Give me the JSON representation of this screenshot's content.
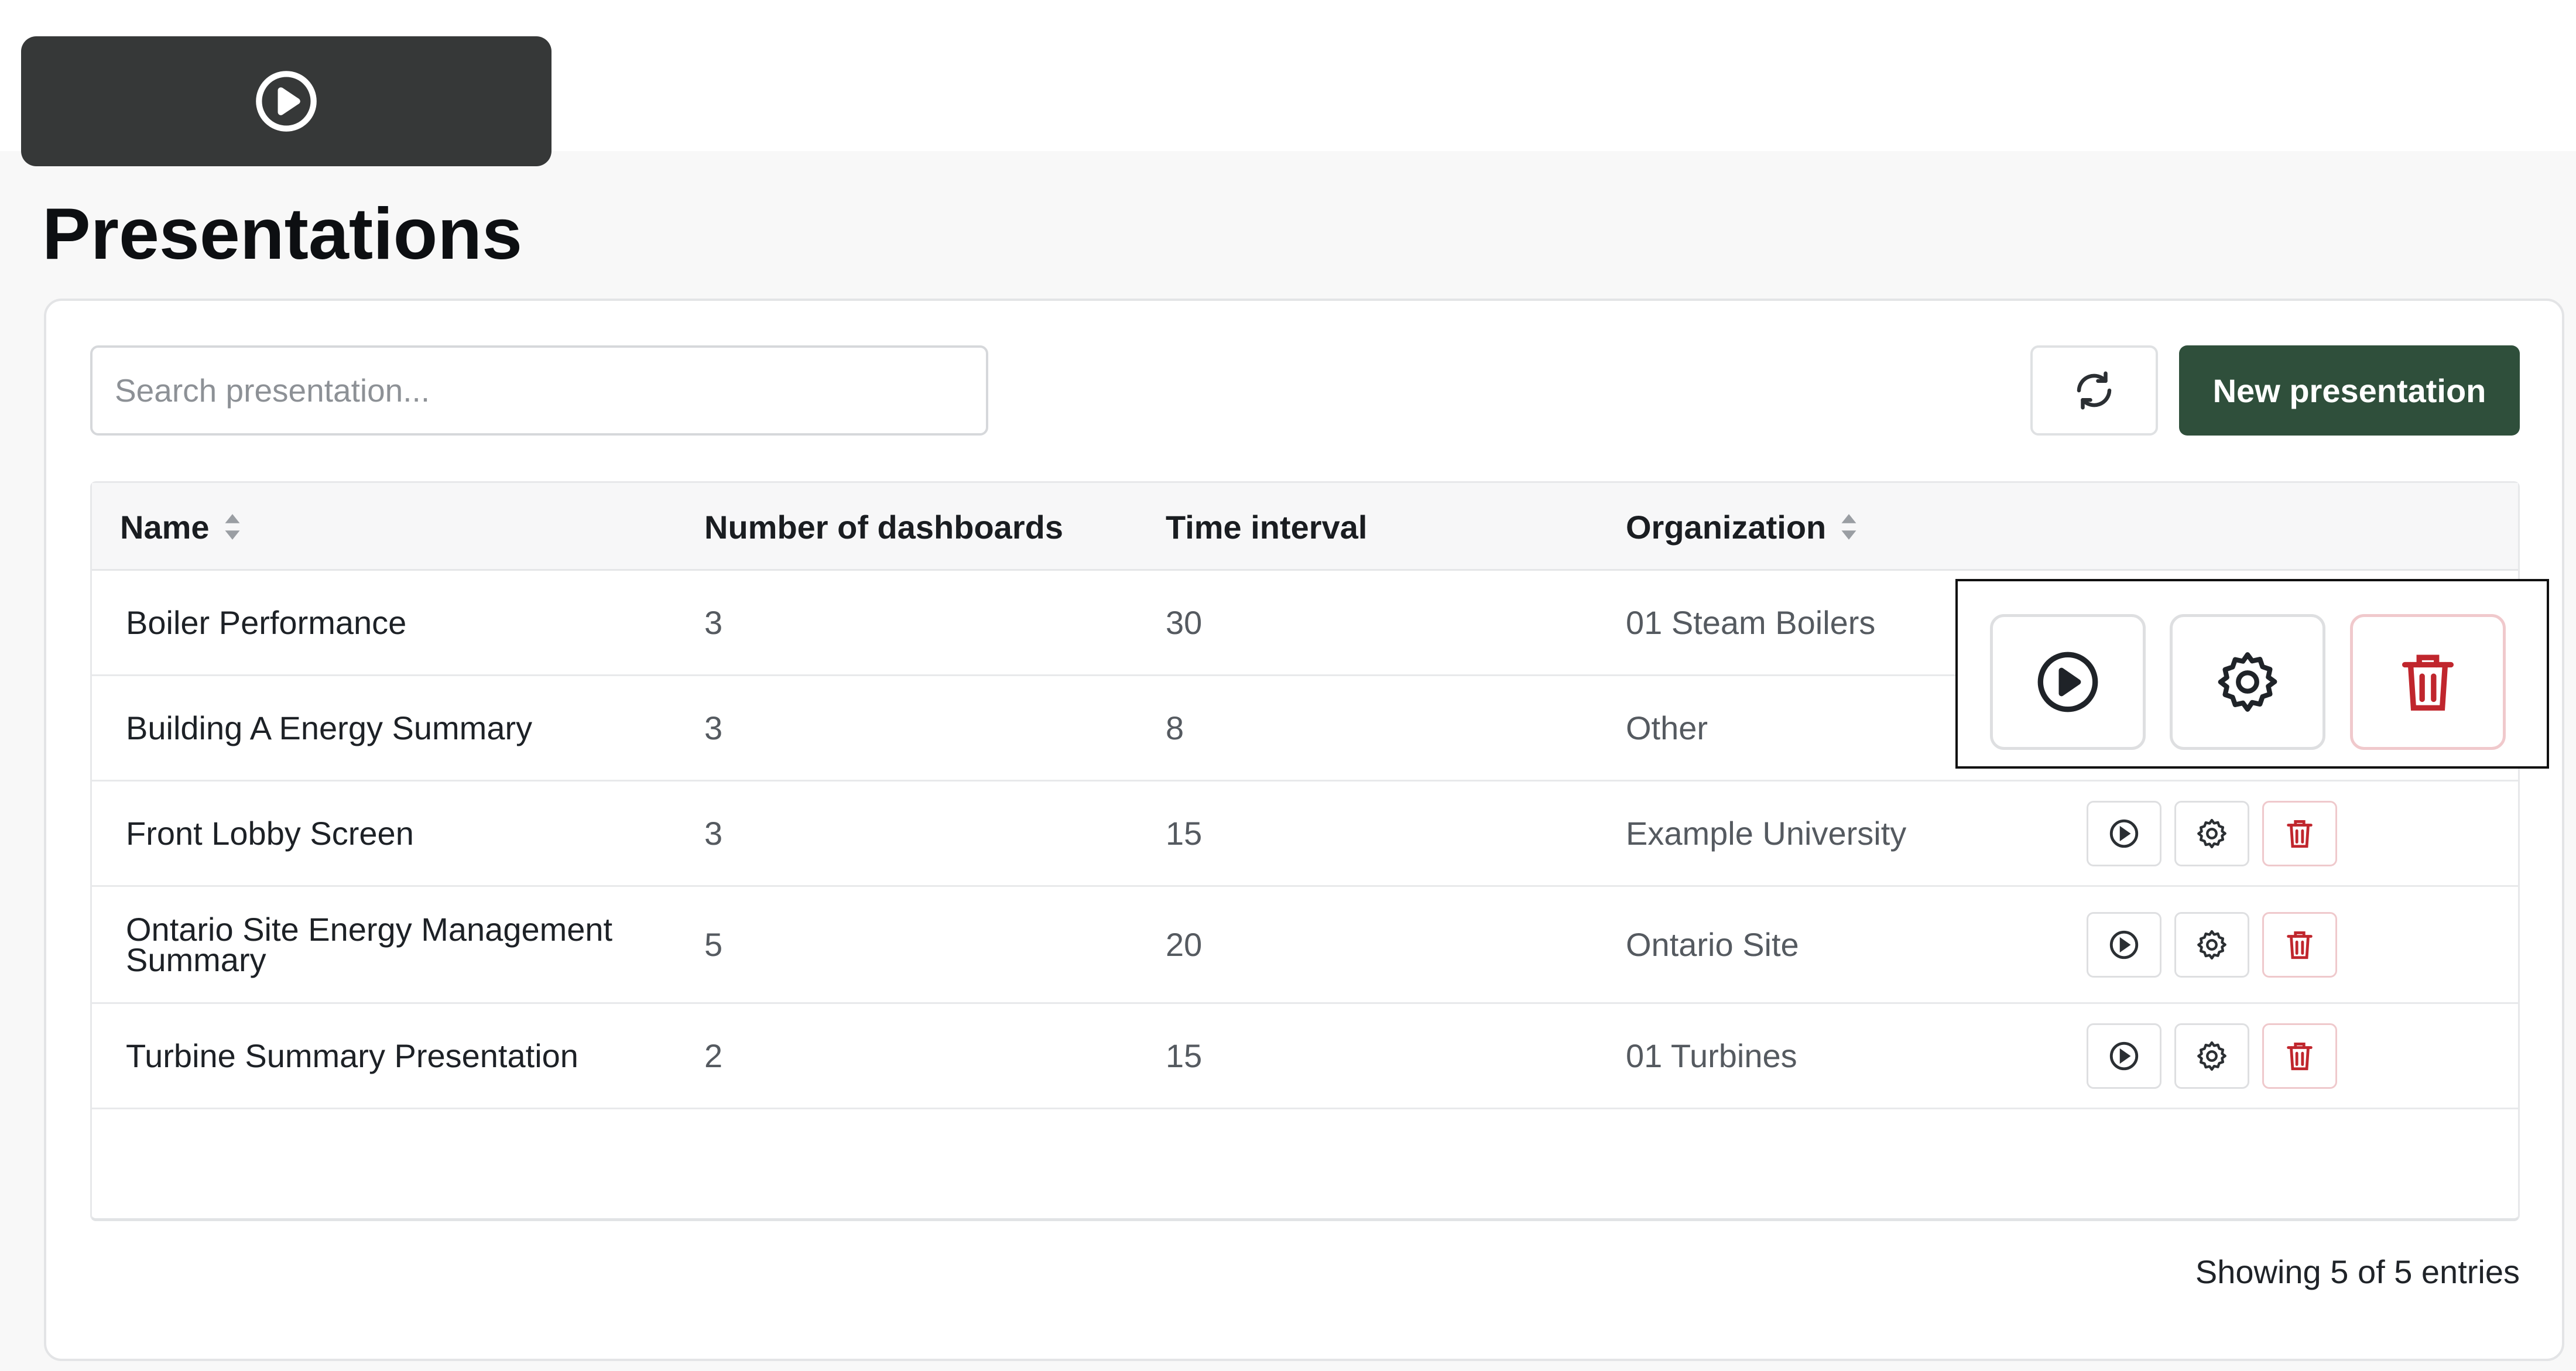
{
  "page": {
    "title": "Presentations",
    "top_tab_icon": "play-circle-icon"
  },
  "toolbar": {
    "search_placeholder": "Search presentation...",
    "search_value": "",
    "refresh_icon": "refresh-icon",
    "new_button_label": "New presentation"
  },
  "table": {
    "columns": [
      {
        "label": "Name",
        "sortable": true
      },
      {
        "label": "Number of dashboards",
        "sortable": false
      },
      {
        "label": "Time interval",
        "sortable": false
      },
      {
        "label": "Organization",
        "sortable": true
      }
    ],
    "rows": [
      {
        "name": "Boiler Performance",
        "dashboards": "3",
        "interval": "30",
        "organization": "01 Steam Boilers"
      },
      {
        "name": "Building A Energy Summary",
        "dashboards": "3",
        "interval": "8",
        "organization": "Other"
      },
      {
        "name": "Front Lobby Screen",
        "dashboards": "3",
        "interval": "15",
        "organization": "Example University"
      },
      {
        "name": "Ontario Site Energy Management Summary",
        "dashboards": "5",
        "interval": "20",
        "organization": "Ontario Site"
      },
      {
        "name": "Turbine Summary Presentation",
        "dashboards": "2",
        "interval": "15",
        "organization": "01 Turbines"
      }
    ],
    "row_actions": [
      "play-icon",
      "gear-icon",
      "trash-icon"
    ]
  },
  "footer": {
    "entries_text": "Showing 5 of 5 entries"
  },
  "colors": {
    "tab_bg": "#363838",
    "primary_button": "#2f4f3b",
    "delete_accent": "#c0262d"
  }
}
